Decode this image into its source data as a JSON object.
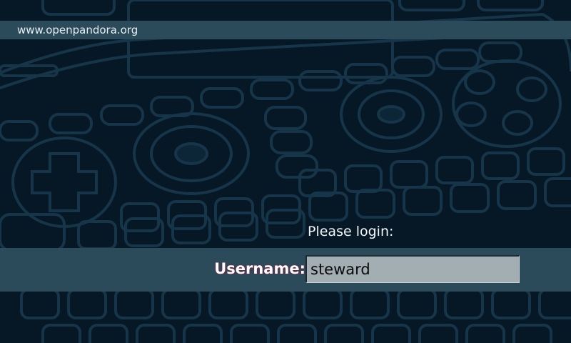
{
  "header": {
    "url_text": "www.openpandora.org"
  },
  "login": {
    "prompt": "Please login:",
    "username_label": "Username:",
    "username_value": "steward"
  },
  "background": {
    "theme": "Pandora handheld console line-art wallpaper",
    "colors": {
      "base": "#061826",
      "outline": "#17384b",
      "bar": "#2b4a5a",
      "input": "#a3aeb2"
    }
  }
}
